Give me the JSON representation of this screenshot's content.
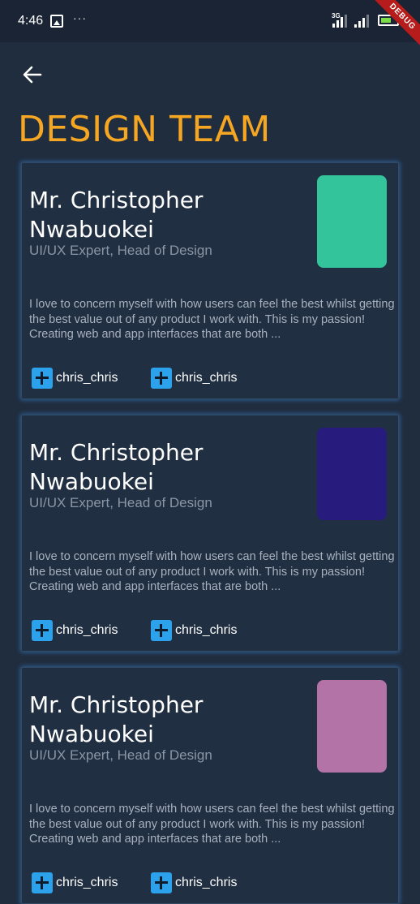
{
  "status_bar": {
    "time": "4:46",
    "more": "···",
    "network": "3G",
    "debug_label": "DEBUG"
  },
  "header": {
    "title": "DESIGN TEAM"
  },
  "members": [
    {
      "name": "Mr. Christopher Nwabuokei",
      "role": "UI/UX Expert, Head of Design",
      "avatar_color": "#34c49c",
      "bio": "I love to concern myself with how users can feel the best whilst getting the best value out of any product I work with. This is my passion! Creating web and app interfaces that are both ...",
      "links": [
        "chris_chris",
        "chris_chris"
      ]
    },
    {
      "name": "Mr. Christopher Nwabuokei",
      "role": "UI/UX Expert, Head of Design",
      "avatar_color": "#271b7e",
      "bio": "I love to concern myself with how users can feel the best whilst getting the best value out of any product I work with. This is my passion! Creating web and app interfaces that are both ...",
      "links": [
        "chris_chris",
        "chris_chris"
      ]
    },
    {
      "name": "Mr. Christopher Nwabuokei",
      "role": "UI/UX Expert, Head of Design",
      "avatar_color": "#b473a6",
      "bio": "I love to concern myself with how users can feel the best whilst getting the best value out of any product I work with. This is my passion! Creating web and app interfaces that are both ...",
      "links": [
        "chris_chris",
        "chris_chris"
      ]
    }
  ],
  "colors": {
    "background": "#202d3f",
    "accent": "#f5a623",
    "link_icon": "#2da2ec"
  }
}
